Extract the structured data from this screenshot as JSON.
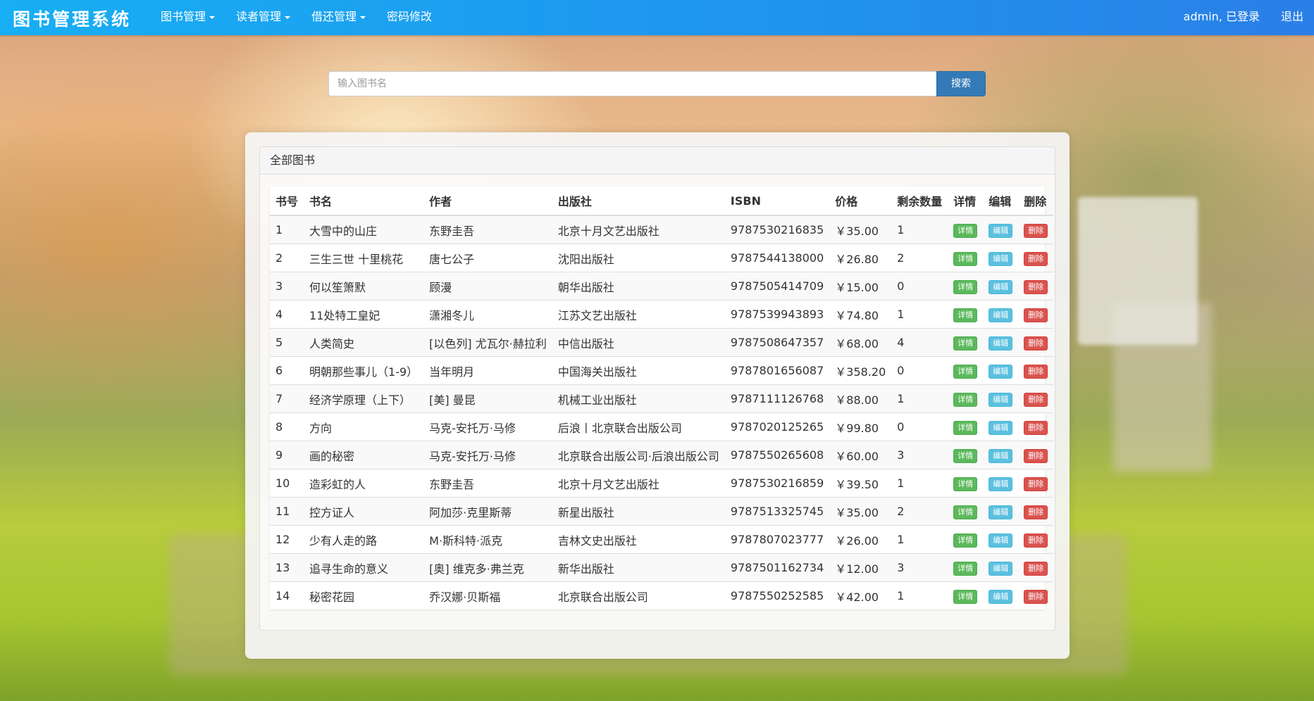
{
  "navbar": {
    "brand": "图书管理系统",
    "menu": [
      {
        "label": "图书管理",
        "dropdown": true
      },
      {
        "label": "读者管理",
        "dropdown": true
      },
      {
        "label": "借还管理",
        "dropdown": true
      },
      {
        "label": "密码修改",
        "dropdown": false
      }
    ],
    "user_status": "admin, 已登录",
    "logout": "退出"
  },
  "search": {
    "placeholder": "输入图书名",
    "button": "搜索"
  },
  "panel": {
    "title": "全部图书"
  },
  "table": {
    "headers": [
      "书号",
      "书名",
      "作者",
      "出版社",
      "ISBN",
      "价格",
      "剩余数量",
      "详情",
      "编辑",
      "删除"
    ],
    "action_labels": {
      "detail": "详情",
      "edit": "编辑",
      "delete": "删除"
    },
    "rows": [
      {
        "id": "1",
        "title": "大雪中的山庄",
        "author": "东野圭吾",
        "publisher": "北京十月文艺出版社",
        "isbn": "9787530216835",
        "price": "￥35.00",
        "stock": "1"
      },
      {
        "id": "2",
        "title": "三生三世 十里桃花",
        "author": "唐七公子",
        "publisher": "沈阳出版社",
        "isbn": "9787544138000",
        "price": "￥26.80",
        "stock": "2"
      },
      {
        "id": "3",
        "title": "何以笙箫默",
        "author": "顾漫",
        "publisher": "朝华出版社",
        "isbn": "9787505414709",
        "price": "￥15.00",
        "stock": "0"
      },
      {
        "id": "4",
        "title": "11处特工皇妃",
        "author": "潇湘冬儿",
        "publisher": "江苏文艺出版社",
        "isbn": "9787539943893",
        "price": "￥74.80",
        "stock": "1"
      },
      {
        "id": "5",
        "title": "人类简史",
        "author": "[以色列] 尤瓦尔·赫拉利",
        "publisher": "中信出版社",
        "isbn": "9787508647357",
        "price": "￥68.00",
        "stock": "4"
      },
      {
        "id": "6",
        "title": "明朝那些事儿（1-9）",
        "author": "当年明月",
        "publisher": "中国海关出版社",
        "isbn": "9787801656087",
        "price": "￥358.20",
        "stock": "0"
      },
      {
        "id": "7",
        "title": "经济学原理（上下）",
        "author": "[美] 曼昆",
        "publisher": "机械工业出版社",
        "isbn": "9787111126768",
        "price": "￥88.00",
        "stock": "1"
      },
      {
        "id": "8",
        "title": "方向",
        "author": "马克-安托万·马修",
        "publisher": "后浪丨北京联合出版公司",
        "isbn": "9787020125265",
        "price": "￥99.80",
        "stock": "0"
      },
      {
        "id": "9",
        "title": "画的秘密",
        "author": "马克-安托万·马修",
        "publisher": "北京联合出版公司·后浪出版公司",
        "isbn": "9787550265608",
        "price": "￥60.00",
        "stock": "3"
      },
      {
        "id": "10",
        "title": "造彩虹的人",
        "author": "东野圭吾",
        "publisher": "北京十月文艺出版社",
        "isbn": "9787530216859",
        "price": "￥39.50",
        "stock": "1"
      },
      {
        "id": "11",
        "title": "控方证人",
        "author": "阿加莎·克里斯蒂",
        "publisher": "新星出版社",
        "isbn": "9787513325745",
        "price": "￥35.00",
        "stock": "2"
      },
      {
        "id": "12",
        "title": "少有人走的路",
        "author": "M·斯科特·派克",
        "publisher": "吉林文史出版社",
        "isbn": "9787807023777",
        "price": "￥26.00",
        "stock": "1"
      },
      {
        "id": "13",
        "title": "追寻生命的意义",
        "author": "[奥] 维克多·弗兰克",
        "publisher": "新华出版社",
        "isbn": "9787501162734",
        "price": "￥12.00",
        "stock": "3"
      },
      {
        "id": "14",
        "title": "秘密花园",
        "author": "乔汉娜·贝斯福",
        "publisher": "北京联合出版公司",
        "isbn": "9787550252585",
        "price": "￥42.00",
        "stock": "1"
      }
    ]
  },
  "colors": {
    "navbar_start": "#17aef3",
    "navbar_end": "#2a7fe6",
    "primary": "#337ab7",
    "success": "#5cb85c",
    "info": "#5bc0de",
    "danger": "#d9534f"
  }
}
